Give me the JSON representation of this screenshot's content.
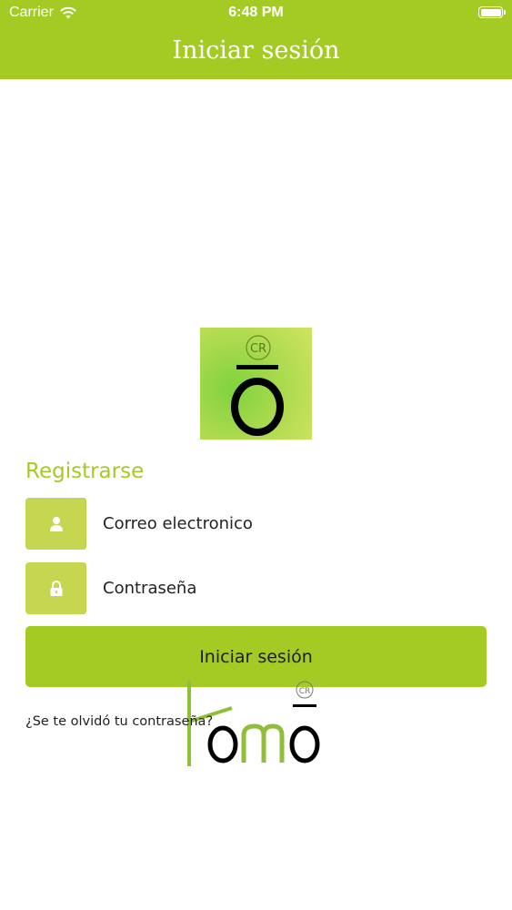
{
  "status_bar": {
    "carrier": "Carrier",
    "time": "6:48 PM"
  },
  "header": {
    "title": "Iniciar sesión"
  },
  "logo": {
    "badge": "CR"
  },
  "form": {
    "section_title": "Registrarse",
    "email_placeholder": "Correo electronico",
    "password_placeholder": "Contraseña",
    "submit_label": "Iniciar sesión",
    "forgot_link": "¿Se te olvidó tu contraseña?"
  },
  "footer_logo": {
    "badge": "CR"
  },
  "colors": {
    "brand_green": "#a4cb24",
    "field_icon_bg": "#c5d650"
  }
}
